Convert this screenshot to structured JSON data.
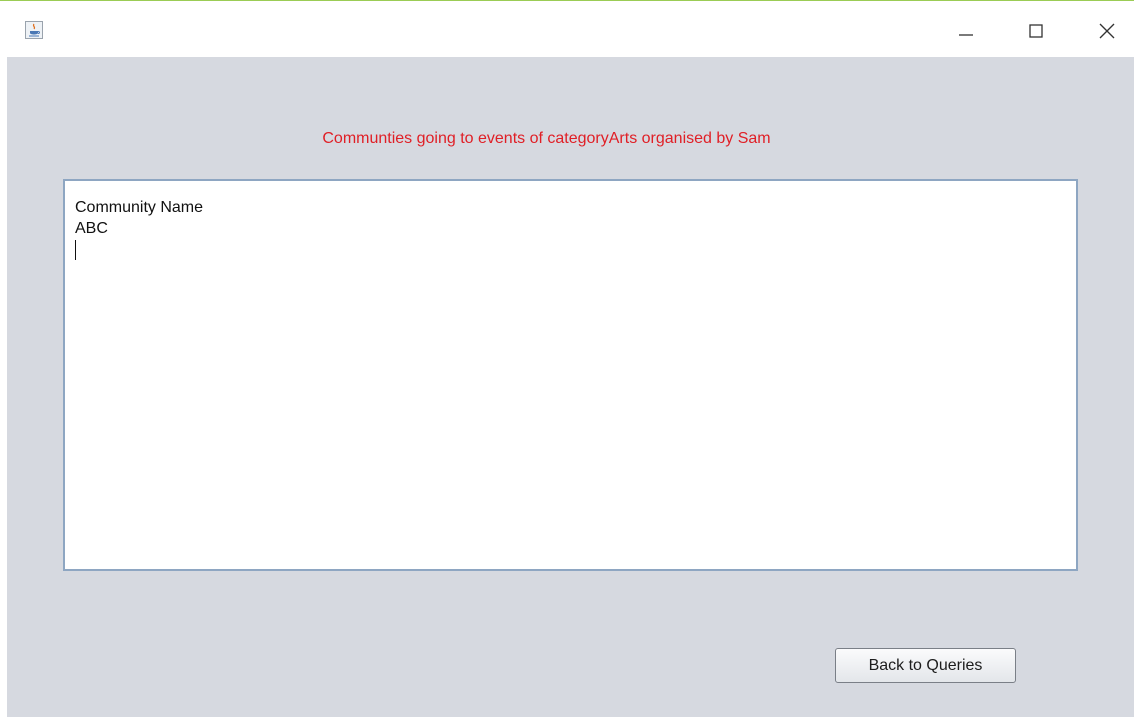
{
  "window": {
    "title": "",
    "controls": {
      "minimize_icon": "minimize-icon",
      "maximize_icon": "maximize-icon",
      "close_icon": "close-icon"
    }
  },
  "heading": "Communties going to events of categoryArts organised by Sam",
  "results": {
    "lines": [
      "Community Name",
      "ABC"
    ]
  },
  "buttons": {
    "back_label": "Back to Queries"
  },
  "colors": {
    "heading": "#e01f26",
    "panel_background": "#d6d9e0",
    "textarea_border": "#8ea6c2",
    "titlebar_accent": "#9bcc55"
  }
}
